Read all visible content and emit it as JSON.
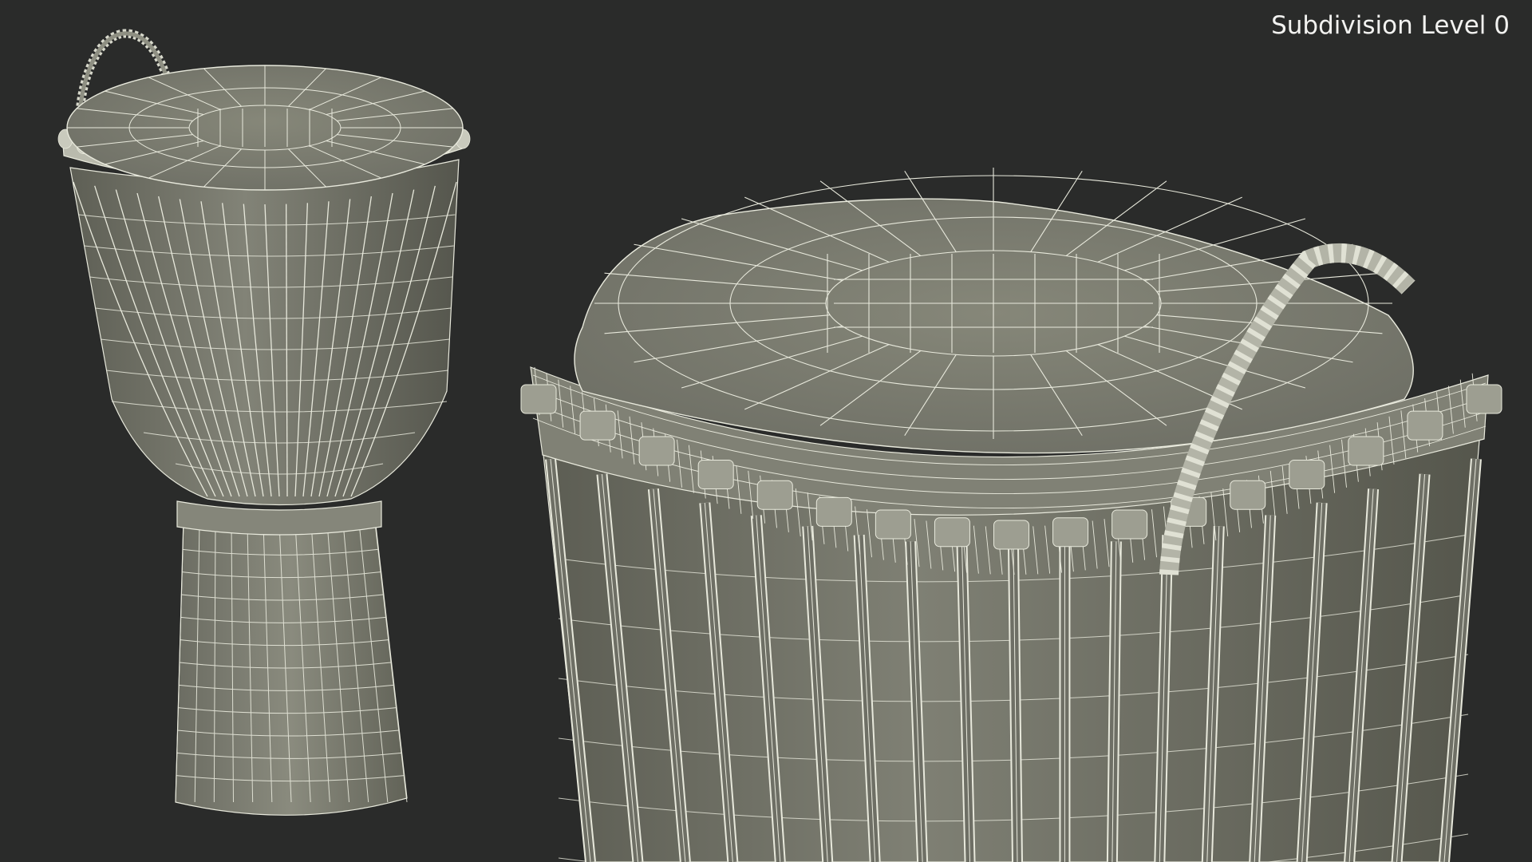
{
  "overlay": {
    "subdivision_label": "Subdivision Level 0"
  },
  "colors": {
    "background": "#2a2b2a",
    "surface": "#7d7e72",
    "surface_dark": "#5e5f55",
    "surface_light": "#8f9083",
    "wire": "#e8e9dc",
    "label_text": "#f2f2f0"
  },
  "scene": {
    "objects": [
      "djembe-full-view",
      "djembe-closeup-view"
    ],
    "render_mode": "wireframe-over-shaded"
  }
}
